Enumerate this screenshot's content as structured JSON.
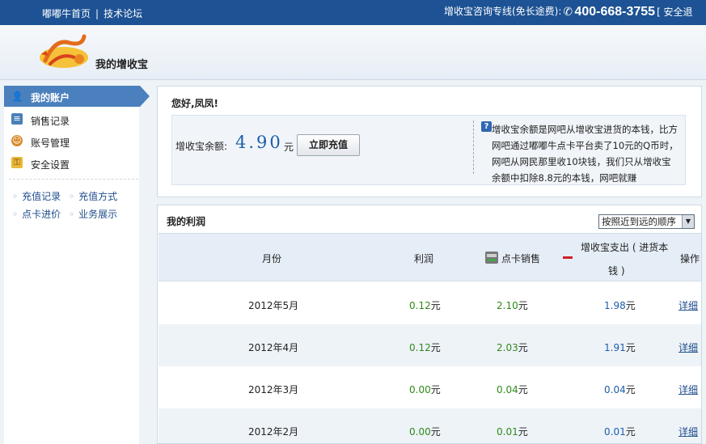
{
  "topbar": {
    "home_link": "嘟嘟牛首页",
    "separator": "|",
    "forum_link": "技术论坛",
    "hotline_label": "增收宝咨询专线(免长途费):",
    "phone": "400-668-3755",
    "logout": "[ 安全退"
  },
  "header": {
    "logo_text": "增收宝",
    "site_name": "我的增收宝"
  },
  "sidebar": {
    "active_item": "我的账户",
    "items": [
      {
        "label": "销售记录",
        "icon": "sales-record-icon",
        "color": "#4a7fb8"
      },
      {
        "label": "账号管理",
        "icon": "account-manage-icon",
        "color": "#d98b2b"
      },
      {
        "label": "安全设置",
        "icon": "security-settings-icon",
        "color": "#d9a52b"
      }
    ],
    "links": [
      "充值记录",
      "充值方式",
      "点卡进价",
      "业务展示"
    ]
  },
  "greeting": {
    "text": "您好,凤凤!",
    "balance_label": "增收宝余额:",
    "balance_amount": "4.90",
    "balance_unit": "元",
    "recharge_button": "立即充值",
    "info_text": "增收宝余额是网吧从增收宝进货的本钱，比方网吧通过嘟嘟牛点卡平台卖了10元的Q币时，网吧从网民那里收10块钱，我们只从增收宝余额中扣除8.8元的本钱，网吧就赚"
  },
  "profit": {
    "title": "我的利润",
    "sort_option": "按照近到远的顺序",
    "headers": {
      "month": "月份",
      "profit": "利润",
      "card_sales": "点卡销售",
      "expense_line1": "增收宝支出 ( 进货本",
      "expense_line2": "钱 )",
      "action": "操作"
    },
    "rows": [
      {
        "month": "2012年5月",
        "profit": "0.12",
        "sales": "2.10",
        "expense": "1.98",
        "action": "详细"
      },
      {
        "month": "2012年4月",
        "profit": "0.12",
        "sales": "2.03",
        "expense": "1.91",
        "action": "详细"
      },
      {
        "month": "2012年3月",
        "profit": "0.00",
        "sales": "0.04",
        "expense": "0.04",
        "action": "详细"
      },
      {
        "month": "2012年2月",
        "profit": "0.00",
        "sales": "0.01",
        "expense": "0.01",
        "action": "详细"
      }
    ],
    "unit": "元"
  }
}
